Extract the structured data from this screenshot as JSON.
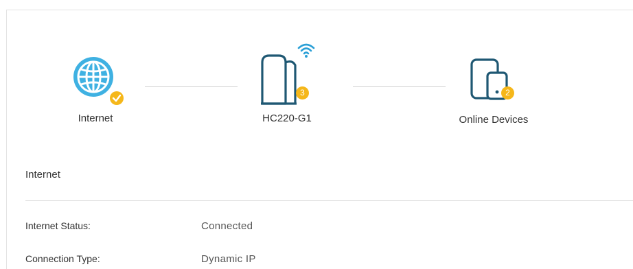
{
  "topology": {
    "internet": {
      "label": "Internet",
      "icon": "globe-icon",
      "status_icon": "check-icon"
    },
    "router": {
      "label": "HC220-G1",
      "icon": "router-icon",
      "wifi_icon": "wifi-icon",
      "badge": "3"
    },
    "devices": {
      "label": "Online Devices",
      "icon": "devices-icon",
      "badge": "2"
    }
  },
  "section": {
    "title": "Internet"
  },
  "details": [
    {
      "label": "Internet Status:",
      "value": "Connected"
    },
    {
      "label": "Connection Type:",
      "value": "Dynamic IP"
    }
  ],
  "colors": {
    "accent": "#2a9fd6",
    "icon_dark": "#1f5873",
    "badge": "#f5b71a",
    "connector": "#cfcfcf"
  }
}
